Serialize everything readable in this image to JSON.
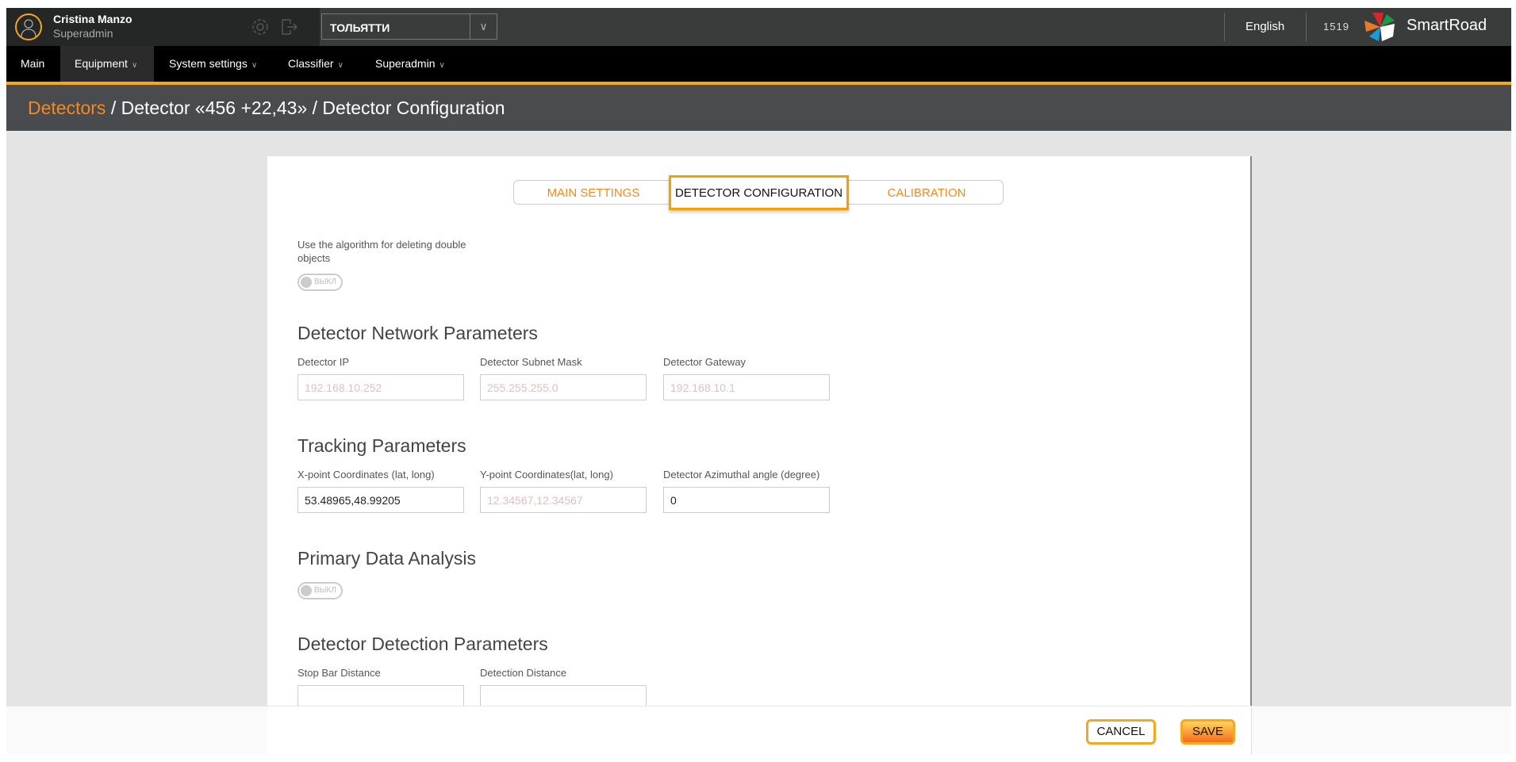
{
  "header": {
    "user_name": "Cristina Manzo",
    "user_role": "Superadmin",
    "city": "ТОЛЬЯТТИ",
    "language": "English",
    "time": "1519",
    "brand": "SmartRoad"
  },
  "nav": [
    {
      "label": "Main"
    },
    {
      "label": "Equipment",
      "active": true
    },
    {
      "label": "System settings"
    },
    {
      "label": "Classifier"
    },
    {
      "label": "Superadmin"
    }
  ],
  "breadcrumb": {
    "link": "Detectors",
    "rest": " / Detector «456 +22,43» / Detector Configuration"
  },
  "tabs": [
    {
      "label": "MAIN SETTINGS"
    },
    {
      "label": "DETECTOR CONFIGURATION",
      "active": true
    },
    {
      "label": "CALIBRATION"
    }
  ],
  "form": {
    "double_objects_label": "Use the algorithm for deleting double objects",
    "double_objects_toggle": "ВЫКЛ",
    "network_title": "Detector Network Parameters",
    "ip_label": "Detector IP",
    "ip_placeholder": "192.168.10.252",
    "mask_label": "Detector Subnet Mask",
    "mask_placeholder": "255.255.255.0",
    "gateway_label": "Detector Gateway",
    "gateway_placeholder": "192.168.10.1",
    "tracking_title": "Tracking Parameters",
    "x_label": "X-point Coordinates (lat, long)",
    "x_value": "53.48965,48.99205",
    "y_label": "Y-point Coordinates(lat, long)",
    "y_placeholder": "12.34567,12.34567",
    "az_label": "Detector Azimuthal angle (degree)",
    "az_value": "0",
    "primary_title": "Primary Data Analysis",
    "primary_toggle": "ВЫКЛ",
    "detection_title": "Detector Detection Parameters",
    "stopbar_label": "Stop Bar Distance",
    "stopbar_value": "",
    "detdist_label": "Detection Distance",
    "detdist_value": ""
  },
  "footer": {
    "cancel": "CANCEL",
    "save": "SAVE"
  },
  "colors": {
    "accent": "#f5a623",
    "link": "#f5891f"
  }
}
